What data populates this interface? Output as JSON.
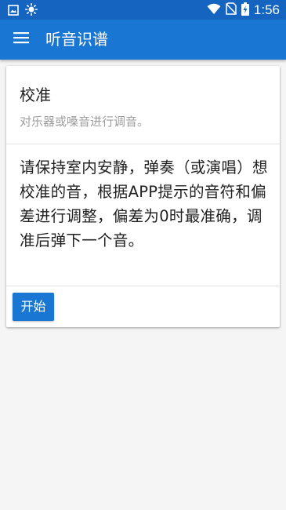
{
  "status_bar": {
    "time": "1:56",
    "icons": [
      "image-notification-icon",
      "brightness-icon",
      "wifi-icon",
      "no-sim-icon",
      "battery-charging-icon"
    ]
  },
  "app_bar": {
    "title": "听音识谱",
    "menu_icon": "hamburger-menu-icon"
  },
  "card": {
    "title": "校准",
    "subtitle": "对乐器或嗓音进行调音。",
    "body": "请保持室内安静，弹奏（或演唱）想校准的音，根据APP提示的音符和偏差进行调整，偏差为0时最准确，调准后弹下一个音。",
    "start_button_label": "开始"
  },
  "colors": {
    "status_bar": "#1565c0",
    "app_bar": "#1976d2",
    "accent": "#1976d2",
    "background": "#f5f5f5",
    "subtitle_text": "#9e9e9e"
  }
}
